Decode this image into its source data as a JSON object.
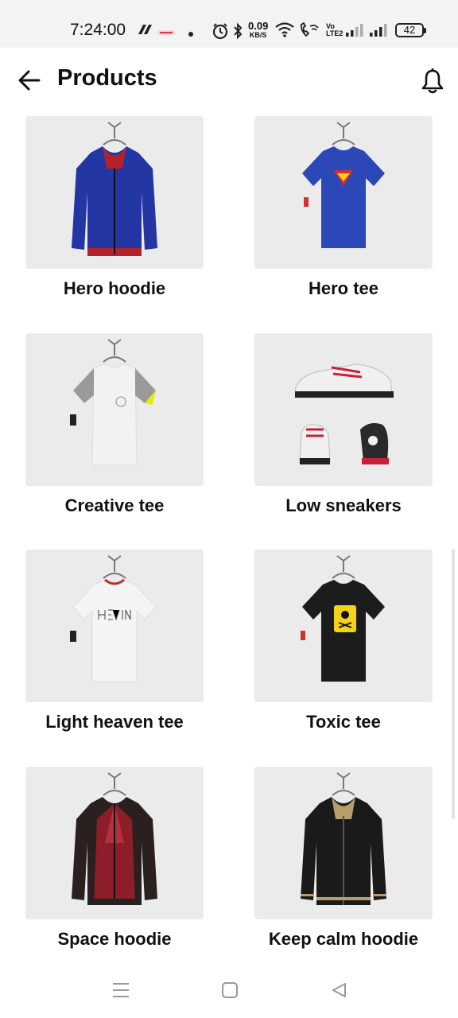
{
  "status_bar": {
    "time": "7:24:00",
    "net_speed_value": "0.09",
    "net_speed_unit": "KB/S",
    "volte_top": "Vo",
    "volte_bottom": "LTE2",
    "battery": "42"
  },
  "app_bar": {
    "title": "Products",
    "back_icon": "arrow-left-icon",
    "bell_icon": "bell-icon"
  },
  "products": [
    {
      "name": "Hero hoodie",
      "kind": "hoodie",
      "color": "#2436a3",
      "accent": "#b2222a"
    },
    {
      "name": "Hero tee",
      "kind": "tee",
      "color": "#2c48b8",
      "accent": "#d33030"
    },
    {
      "name": "Creative tee",
      "kind": "tee",
      "color": "#f2f2f2",
      "accent": "#9a9a9a"
    },
    {
      "name": "Low sneakers",
      "kind": "sneakers",
      "color": "#f0f0f0",
      "accent": "#c7213a"
    },
    {
      "name": "Light heaven tee",
      "kind": "tee",
      "color": "#f4f4f4",
      "accent": "#c42a2a"
    },
    {
      "name": "Toxic tee",
      "kind": "tee",
      "color": "#1c1c1c",
      "accent": "#f4d21c"
    },
    {
      "name": "Space hoodie",
      "kind": "hoodie",
      "color": "#2a2020",
      "accent": "#8e1d2a"
    },
    {
      "name": "Keep calm hoodie",
      "kind": "hoodie",
      "color": "#1a1a1a",
      "accent": "#b89c6a"
    }
  ],
  "nav_bar": {
    "menu_icon": "menu-icon",
    "home_icon": "home-square-icon",
    "back_icon": "back-triangle-icon"
  }
}
